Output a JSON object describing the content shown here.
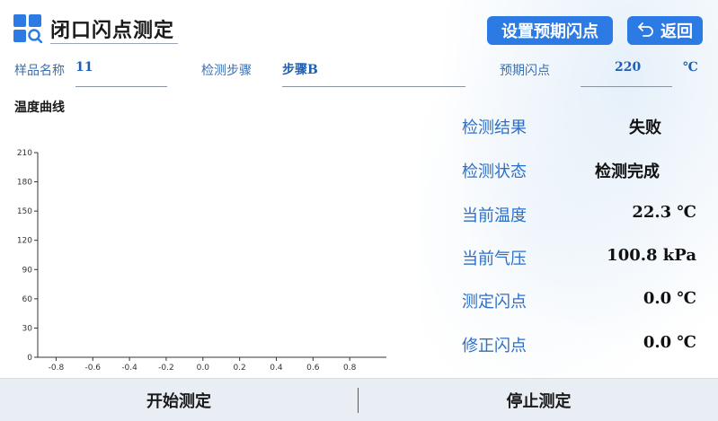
{
  "header": {
    "title": "闭口闪点测定",
    "set_flash_button": "设置预期闪点",
    "back_button": "返回"
  },
  "sample": {
    "name_label": "样品名称",
    "name_value": "11",
    "step_label": "检测步骤",
    "step_value": "步骤B",
    "expected_label": "预期闪点",
    "expected_value": "220",
    "expected_unit": "℃"
  },
  "chart_title": "温度曲线",
  "chart_data": {
    "type": "line",
    "title": "温度曲线",
    "xlabel": "",
    "ylabel": "",
    "x_ticks": [
      "-0.8",
      "-0.6",
      "-0.4",
      "-0.2",
      "0.0",
      "0.2",
      "0.4",
      "0.6",
      "0.8"
    ],
    "y_ticks": [
      "0",
      "30",
      "60",
      "90",
      "120",
      "150",
      "180",
      "210"
    ],
    "xlim": [
      -0.9,
      1.0
    ],
    "ylim": [
      0,
      210
    ],
    "series": []
  },
  "results": [
    {
      "label": "检测结果",
      "value": "失败"
    },
    {
      "label": "检测状态",
      "value": "检测完成"
    },
    {
      "label": "当前温度",
      "value": "22.3 ℃"
    },
    {
      "label": "当前气压",
      "value": "100.8 kPa"
    },
    {
      "label": "测定闪点",
      "value": "0.0 ℃"
    },
    {
      "label": "修正闪点",
      "value": "0.0 ℃"
    }
  ],
  "footer": {
    "start_button": "开始测定",
    "stop_button": "停止测定"
  },
  "colors": {
    "accent": "#2c7be5",
    "label_blue": "#2c6fc7",
    "bottom_bar": "#e9eef4"
  },
  "icons": {
    "logo": "grid-search-icon",
    "back": "undo-arrow-icon"
  }
}
